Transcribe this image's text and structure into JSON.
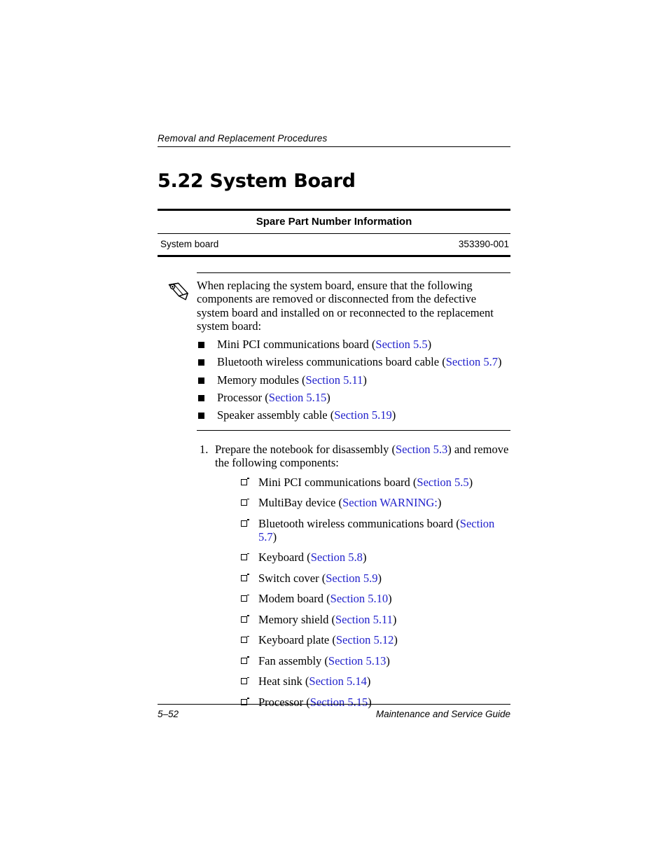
{
  "header": {
    "running_head": "Removal and Replacement Procedures"
  },
  "title": {
    "number": "5.22",
    "text": "System Board"
  },
  "spare_part_table": {
    "header": "Spare Part Number Information",
    "rows": [
      {
        "name": "System board",
        "part_number": "353390-001"
      }
    ]
  },
  "note": {
    "icon": "pencil-note-icon",
    "text": "When replacing the system board, ensure that the following components are removed or disconnected from the defective system board and installed on or reconnected to the replacement system board:",
    "items": [
      {
        "label": "Mini PCI communications board (",
        "link": "Section 5.5",
        "tail": ")"
      },
      {
        "label": "Bluetooth wireless communications board cable (",
        "link": "Section 5.7",
        "tail": ")"
      },
      {
        "label": "Memory modules (",
        "link": "Section 5.11",
        "tail": ")"
      },
      {
        "label": "Processor (",
        "link": "Section 5.15",
        "tail": ")"
      },
      {
        "label": "Speaker assembly cable (",
        "link": "Section 5.19",
        "tail": ")"
      }
    ]
  },
  "steps": [
    {
      "number": "1.",
      "text_before": "Prepare the notebook for disassembly (",
      "link": "Section 5.3",
      "text_after": ") and remove the following components:",
      "sub_items": [
        {
          "label": "Mini PCI communications board (",
          "link": "Section 5.5",
          "tail": ")"
        },
        {
          "label": "MultiBay device (",
          "link": "Section WARNING:",
          "tail": ")"
        },
        {
          "label": "Bluetooth wireless communications board (",
          "link": "Section 5.7",
          "tail": ")"
        },
        {
          "label": "Keyboard (",
          "link": "Section 5.8",
          "tail": ")"
        },
        {
          "label": "Switch cover (",
          "link": "Section 5.9",
          "tail": ")"
        },
        {
          "label": "Modem board (",
          "link": "Section 5.10",
          "tail": ")"
        },
        {
          "label": "Memory shield (",
          "link": "Section 5.11",
          "tail": ")"
        },
        {
          "label": "Keyboard plate (",
          "link": "Section 5.12",
          "tail": ")"
        },
        {
          "label": "Fan assembly (",
          "link": "Section 5.13",
          "tail": ")"
        },
        {
          "label": "Heat sink (",
          "link": "Section 5.14",
          "tail": ")"
        },
        {
          "label": "Processor (",
          "link": "Section 5.15",
          "tail": ")"
        }
      ]
    }
  ],
  "footer": {
    "page_number": "5–52",
    "guide_title": "Maintenance and Service Guide"
  },
  "colors": {
    "link": "#2222cc",
    "text": "#000000",
    "background": "#ffffff"
  }
}
